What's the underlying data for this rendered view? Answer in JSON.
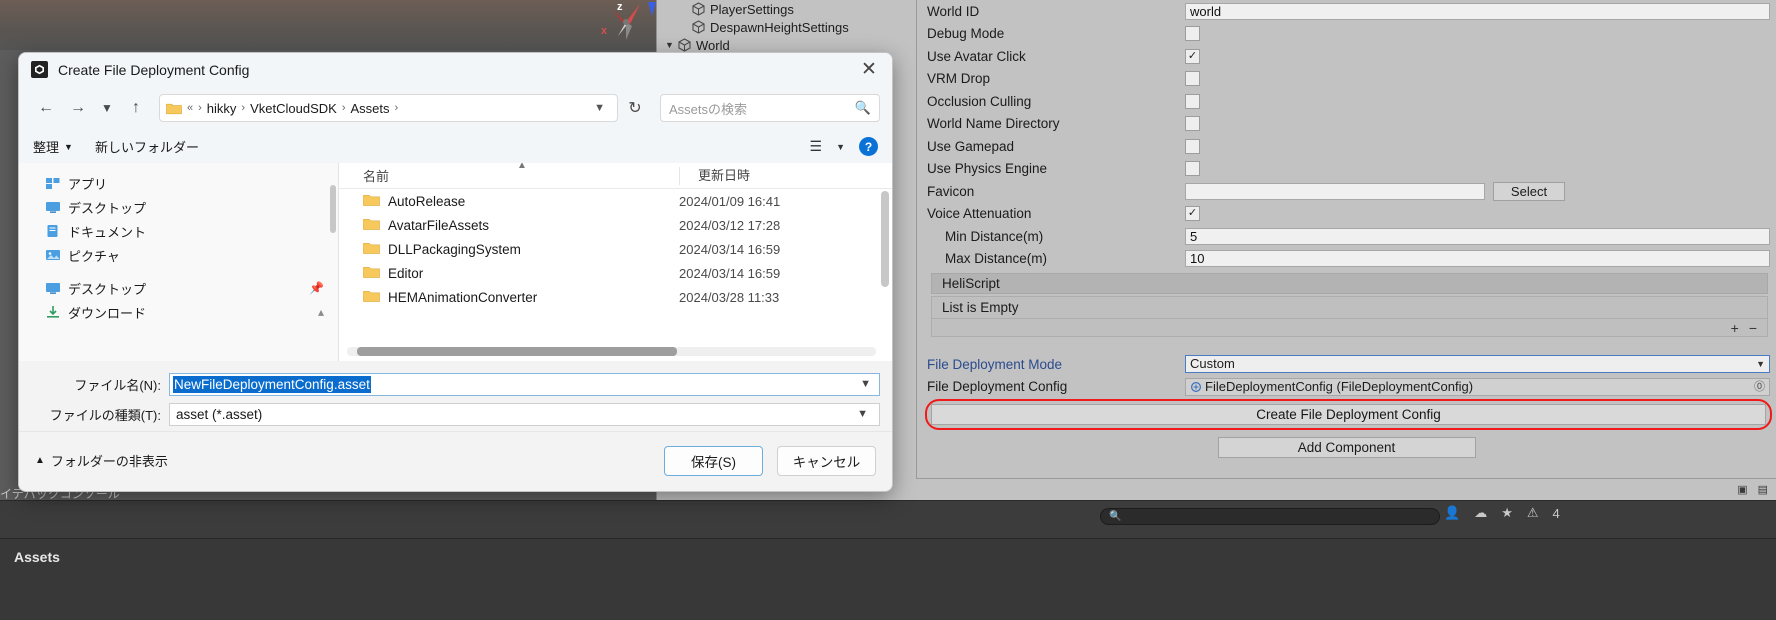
{
  "dialog": {
    "title": "Create File Deployment Config",
    "app_icon": "unity-icon",
    "close_icon": "close-icon",
    "nav": {
      "back_icon": "arrow-left-icon",
      "forward_icon": "arrow-right-icon",
      "recent_icon": "chevron-down-icon",
      "up_icon": "arrow-up-icon",
      "refresh_icon": "refresh-icon",
      "address_prefix": "«",
      "breadcrumbs": [
        "hikky",
        "VketCloudSDK",
        "Assets"
      ],
      "address_caret_icon": "chevron-down-icon",
      "search_placeholder": "Assetsの検索",
      "search_icon": "search-icon"
    },
    "toolbar": {
      "organize": "整理",
      "organize_caret_icon": "chevron-down-icon",
      "new_folder": "新しいフォルダー",
      "view_icon": "list-view-icon",
      "view_caret_icon": "chevron-down-icon",
      "help_label": "?",
      "help_icon": "help-icon"
    },
    "sidebar": {
      "items": [
        {
          "label": "アプリ",
          "icon": "apps-icon",
          "pinned": false
        },
        {
          "label": "デスクトップ",
          "icon": "desktop-icon",
          "pinned": false
        },
        {
          "label": "ドキュメント",
          "icon": "documents-icon",
          "pinned": false
        },
        {
          "label": "ピクチャ",
          "icon": "pictures-icon",
          "pinned": false
        }
      ],
      "items2": [
        {
          "label": "デスクトップ",
          "icon": "desktop-icon",
          "pinned": true
        },
        {
          "label": "ダウンロード",
          "icon": "downloads-icon",
          "pinned": true
        }
      ]
    },
    "files": {
      "columns": {
        "name": "名前",
        "date": "更新日時"
      },
      "sort_caret_icon": "chevron-up-icon",
      "rows": [
        {
          "name": "AutoRelease",
          "date": "2024/01/09 16:41",
          "icon": "folder-icon"
        },
        {
          "name": "AvatarFileAssets",
          "date": "2024/03/12 17:28",
          "icon": "folder-icon"
        },
        {
          "name": "DLLPackagingSystem",
          "date": "2024/03/14 16:59",
          "icon": "folder-icon"
        },
        {
          "name": "Editor",
          "date": "2024/03/14 16:59",
          "icon": "folder-icon"
        },
        {
          "name": "HEMAnimationConverter",
          "date": "2024/03/28 11:33",
          "icon": "folder-icon"
        }
      ]
    },
    "fields": {
      "filename_label": "ファイル名(N):",
      "filename_value": "NewFileDeploymentConfig.asset",
      "filename_caret_icon": "chevron-down-icon",
      "filetype_label": "ファイルの種類(T):",
      "filetype_value": "asset (*.asset)",
      "filetype_caret_icon": "chevron-down-icon"
    },
    "footer": {
      "hide_folders": "フォルダーの非表示",
      "hide_folders_icon": "chevron-up-icon",
      "save": "保存(S)",
      "cancel": "キャンセル"
    }
  },
  "hierarchy": {
    "items": [
      {
        "label": "PlayerSettings",
        "indent": 1,
        "expandable": false
      },
      {
        "label": "DespawnHeightSettings",
        "indent": 1,
        "expandable": false
      },
      {
        "label": "World",
        "indent": 0,
        "expandable": true,
        "arrow_icon": "triangle-down-icon"
      }
    ]
  },
  "inspector": {
    "rows": [
      {
        "label": "World ID",
        "type": "text",
        "value": "world"
      },
      {
        "label": "Debug Mode",
        "type": "checkbox",
        "checked": false
      },
      {
        "label": "Use Avatar Click",
        "type": "checkbox",
        "checked": true
      },
      {
        "label": "VRM Drop",
        "type": "checkbox",
        "checked": false
      },
      {
        "label": "Occlusion Culling",
        "type": "checkbox",
        "checked": false
      },
      {
        "label": "World Name Directory",
        "type": "checkbox",
        "checked": false
      },
      {
        "label": "Use Gamepad",
        "type": "checkbox",
        "checked": false
      },
      {
        "label": "Use Physics Engine",
        "type": "checkbox",
        "checked": false
      }
    ],
    "favicon": {
      "label": "Favicon",
      "select_button": "Select"
    },
    "voice_attenuation": {
      "label": "Voice Attenuation",
      "checked": true
    },
    "min_distance": {
      "label": "Min Distance(m)",
      "value": "5"
    },
    "max_distance": {
      "label": "Max Distance(m)",
      "value": "10"
    },
    "heliscript": {
      "header": "HeliScript",
      "empty_text": "List is Empty",
      "add_icon": "plus-icon",
      "remove_icon": "minus-icon"
    },
    "deployment_mode": {
      "label": "File Deployment Mode",
      "value": "Custom",
      "caret_icon": "chevron-down-icon"
    },
    "deployment_config": {
      "label": "File Deployment Config",
      "value": "FileDeploymentConfig (FileDeploymentConfig)",
      "object_icon": "scriptable-object-icon",
      "clear_icon": "circle-x-icon"
    },
    "create_button": "Create File Deployment Config",
    "add_component": "Add Component",
    "highlight_color": "#f01a1a"
  },
  "statusbar": {
    "console_tab": "イテパックコンソール",
    "assets_label": "Assets",
    "search_placeholder": "",
    "search_icon": "search-icon",
    "error_count": "4",
    "icons": [
      "account-icon",
      "cloud-icon",
      "layers-icon",
      "error-icon"
    ]
  },
  "scene": {
    "gizmo_z": "z",
    "gizmo_x": "x",
    "gizmo_z2": "z"
  }
}
